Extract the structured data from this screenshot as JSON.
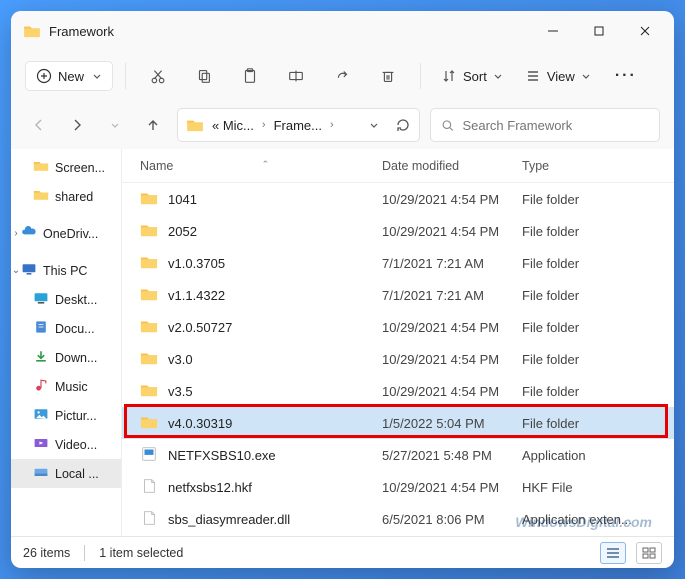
{
  "titlebar": {
    "title": "Framework"
  },
  "toolbar": {
    "new": "New",
    "sort": "Sort",
    "view": "View"
  },
  "nav": {
    "crumb1": "« Mic...",
    "crumb2": "Frame...",
    "search_placeholder": "Search Framework"
  },
  "columns": {
    "name": "Name",
    "date": "Date modified",
    "type": "Type"
  },
  "sidebar": [
    {
      "label": "Screen...",
      "icon": "folder",
      "indent": "sub"
    },
    {
      "label": "shared",
      "icon": "folder",
      "indent": "sub"
    },
    {
      "label": "OneDriv...",
      "icon": "onedrive",
      "indent": "main",
      "caret": "›"
    },
    {
      "label": "This PC",
      "icon": "pc",
      "indent": "main",
      "caret": "⌄"
    },
    {
      "label": "Deskt...",
      "icon": "desktop",
      "indent": "sub"
    },
    {
      "label": "Docu...",
      "icon": "docs",
      "indent": "sub"
    },
    {
      "label": "Down...",
      "icon": "down",
      "indent": "sub"
    },
    {
      "label": "Music",
      "icon": "music",
      "indent": "sub"
    },
    {
      "label": "Pictur...",
      "icon": "pics",
      "indent": "sub"
    },
    {
      "label": "Video...",
      "icon": "video",
      "indent": "sub"
    },
    {
      "label": "Local ...",
      "icon": "disk",
      "indent": "sub",
      "sel": true
    }
  ],
  "rows": [
    {
      "name": "1041",
      "date": "10/29/2021 4:54 PM",
      "type": "File folder",
      "icon": "folder"
    },
    {
      "name": "2052",
      "date": "10/29/2021 4:54 PM",
      "type": "File folder",
      "icon": "folder"
    },
    {
      "name": "v1.0.3705",
      "date": "7/1/2021 7:21 AM",
      "type": "File folder",
      "icon": "folder"
    },
    {
      "name": "v1.1.4322",
      "date": "7/1/2021 7:21 AM",
      "type": "File folder",
      "icon": "folder"
    },
    {
      "name": "v2.0.50727",
      "date": "10/29/2021 4:54 PM",
      "type": "File folder",
      "icon": "folder"
    },
    {
      "name": "v3.0",
      "date": "10/29/2021 4:54 PM",
      "type": "File folder",
      "icon": "folder"
    },
    {
      "name": "v3.5",
      "date": "10/29/2021 4:54 PM",
      "type": "File folder",
      "icon": "folder"
    },
    {
      "name": "v4.0.30319",
      "date": "1/5/2022 5:04 PM",
      "type": "File folder",
      "icon": "folder",
      "sel": true,
      "hl": true
    },
    {
      "name": "NETFXSBS10.exe",
      "date": "5/27/2021 5:48 PM",
      "type": "Application",
      "icon": "exe"
    },
    {
      "name": "netfxsbs12.hkf",
      "date": "10/29/2021 4:54 PM",
      "type": "HKF File",
      "icon": "file"
    },
    {
      "name": "sbs_diasymreader.dll",
      "date": "6/5/2021 8:06 PM",
      "type": "Application exten...",
      "icon": "file"
    }
  ],
  "status": {
    "count": "26 items",
    "sel": "1 item selected"
  },
  "watermark": "WindowsDigital.com"
}
